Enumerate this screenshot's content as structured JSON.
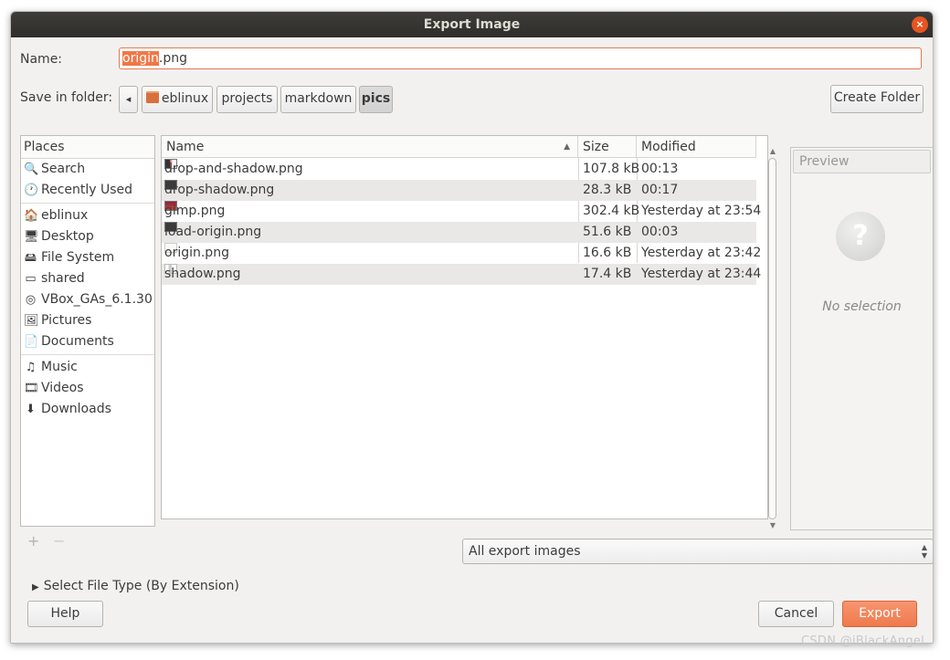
{
  "window": {
    "title": "Export Image",
    "close_icon": "×"
  },
  "name_field": {
    "label": "Name:",
    "value_selected": "origin",
    "value_rest": ".png"
  },
  "save_in": {
    "label": "Save in folder:",
    "back_icon": "◂",
    "crumbs": [
      "eblinux",
      "projects",
      "markdown",
      "pics"
    ],
    "active": "pics",
    "create_folder_label": "Create Folder"
  },
  "places": {
    "header": "Places",
    "items": [
      {
        "label": "Search",
        "icon": "search-icon",
        "glyph": "🔍"
      },
      {
        "label": "Recently Used",
        "icon": "recent-icon",
        "glyph": "🕐"
      },
      {
        "label": "eblinux",
        "icon": "home-folder-icon",
        "glyph": "🏠"
      },
      {
        "label": "Desktop",
        "icon": "desktop-icon",
        "glyph": "🖥"
      },
      {
        "label": "File System",
        "icon": "drive-icon",
        "glyph": "🖴"
      },
      {
        "label": "shared",
        "icon": "shared-drive-icon",
        "glyph": "▭"
      },
      {
        "label": "VBox_GAs_6.1.30",
        "icon": "disc-icon",
        "glyph": "◎"
      },
      {
        "label": "Pictures",
        "icon": "pictures-icon",
        "glyph": "🖼"
      },
      {
        "label": "Documents",
        "icon": "documents-icon",
        "glyph": "📄"
      },
      {
        "label": "Music",
        "icon": "music-icon",
        "glyph": "♫"
      },
      {
        "label": "Videos",
        "icon": "videos-icon",
        "glyph": "🎞"
      },
      {
        "label": "Downloads",
        "icon": "downloads-icon",
        "glyph": "⬇"
      }
    ],
    "add_icon": "+",
    "remove_icon": "−"
  },
  "files": {
    "columns": {
      "name": "Name",
      "size": "Size",
      "modified": "Modified",
      "sort_icon": "▲"
    },
    "rows": [
      {
        "name": "drop-and-shadow.png",
        "size": "107.8 kB",
        "modified": "00:13"
      },
      {
        "name": "drop-shadow.png",
        "size": "28.3 kB",
        "modified": "00:17"
      },
      {
        "name": "gimp.png",
        "size": "302.4 kB",
        "modified": "Yesterday at 23:54"
      },
      {
        "name": "load-origin.png",
        "size": "51.6 kB",
        "modified": "00:03"
      },
      {
        "name": "origin.png",
        "size": "16.6 kB",
        "modified": "Yesterday at 23:42"
      },
      {
        "name": "shadow.png",
        "size": "17.4 kB",
        "modified": "Yesterday at 23:44"
      }
    ]
  },
  "preview": {
    "button_label": "Preview",
    "no_selection": "No selection",
    "icon_glyph": "?"
  },
  "filter": {
    "value": "All export images",
    "icon": "updown-icon"
  },
  "file_type_expander": {
    "label": "Select File Type (By Extension)",
    "icon": "▶"
  },
  "buttons": {
    "help": "Help",
    "cancel": "Cancel",
    "export": "Export"
  },
  "watermark": "CSDN @iBlackAngel",
  "colors": {
    "accent": "#e95420",
    "selection": "#f07746",
    "titlebar": "#3d3c38"
  }
}
